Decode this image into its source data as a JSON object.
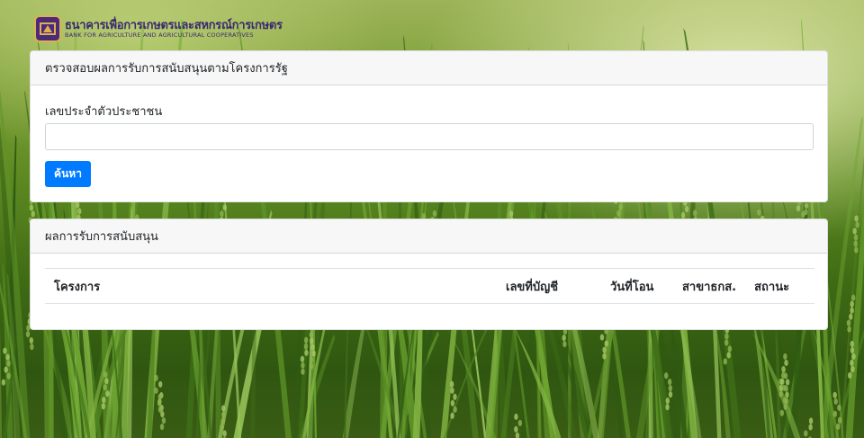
{
  "brand": {
    "name_th": "ธนาคารเพื่อการเกษตรและสหกรณ์การเกษตร",
    "name_en": "BANK FOR AGRICULTURE AND AGRICULTURAL COOPERATIVES",
    "primary_color": "#007bff",
    "logo_color": "#4a2a7a"
  },
  "search_card": {
    "title": "ตรวจสอบผลการรับการสนับสนุนตามโครงการรัฐ",
    "id_label": "เลขประจำตัวประชาชน",
    "id_value": "",
    "search_button": "ค้นหา"
  },
  "results_card": {
    "title": "ผลการรับการสนับสนุน",
    "columns": [
      "โครงการ",
      "เลขที่บัญชี",
      "วันที่โอน",
      "สาขาธกส.",
      "สถานะ"
    ]
  }
}
